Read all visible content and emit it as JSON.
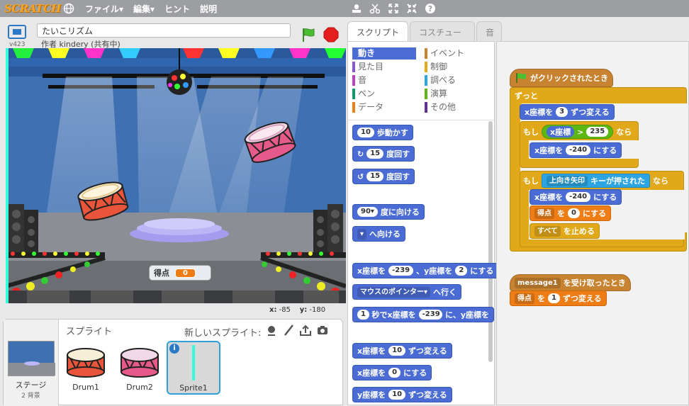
{
  "topbar": {
    "logo": "SCRATCH",
    "menus": [
      "ファイル▾",
      "編集▾",
      "ヒント",
      "説明"
    ]
  },
  "project": {
    "version": "v423",
    "title": "たいこリズム",
    "author": "作者 kindery (共有中)"
  },
  "stage": {
    "score_label": "得点",
    "score_value": "0",
    "x_label": "x:",
    "x_value": "-85",
    "y_label": "y:",
    "y_value": "-180"
  },
  "sprites": {
    "header": "スプライト",
    "new_sprite": "新しいスプライト:",
    "stage_label": "ステージ",
    "stage_sub": "2 背景",
    "items": [
      "Drum1",
      "Drum2",
      "Sprite1"
    ]
  },
  "tabs": [
    "スクリプト",
    "コスチューム",
    "音"
  ],
  "categories": {
    "left": [
      "動き",
      "見た目",
      "音",
      "ペン",
      "データ"
    ],
    "right": [
      "イベント",
      "制御",
      "調べる",
      "演算",
      "その他"
    ]
  },
  "palette": {
    "move": {
      "v": "10",
      "t": "歩動かす"
    },
    "turn_r": {
      "v": "15",
      "t": "度回す"
    },
    "turn_l": {
      "v": "15",
      "t": "度回す"
    },
    "point_dir": {
      "v": "90▾",
      "t": "度に向ける"
    },
    "point_to": {
      "v": "▾",
      "t": "へ向ける"
    },
    "goto_xy": {
      "a": "x座標を",
      "x": "-239",
      "b": "、y座標を",
      "y": "2",
      "c": "にする"
    },
    "goto_mouse": {
      "v": "マウスのポインター▾",
      "t": "へ行く"
    },
    "glide": {
      "s": "1",
      "a": "秒でx座標を",
      "x": "-239",
      "b": "に、y座標を"
    },
    "change_x": {
      "a": "x座標を",
      "v": "10",
      "t": "ずつ変える"
    },
    "set_x": {
      "a": "x座標を",
      "v": "0",
      "t": "にする"
    },
    "change_y": {
      "a": "y座標を",
      "v": "10",
      "t": "ずつ変える"
    }
  },
  "script": {
    "hat1": "がクリックされたとき",
    "forever": "ずっと",
    "cx": {
      "a": "x座標を",
      "v": "3",
      "t": "ずつ変える"
    },
    "if1": {
      "a": "もし",
      "prop": "x座標",
      "op": ">",
      "v": "235",
      "b": "なら"
    },
    "setx1": {
      "a": "x座標を",
      "v": "-240",
      "t": "にする"
    },
    "if2": {
      "a": "もし",
      "key": "上向き矢印",
      "t": "キーが押された",
      "b": "なら"
    },
    "setx2": {
      "a": "x座標を",
      "v": "-240",
      "t": "にする"
    },
    "setscore": {
      "var": "得点",
      "a": "を",
      "v": "0",
      "t": "にする"
    },
    "stop": {
      "v": "すべて",
      "t": "を止める"
    },
    "hat2": {
      "msg": "message1",
      "t": "を受け取ったとき"
    },
    "change_score": {
      "var": "得点",
      "a": "を",
      "v": "1",
      "t": "ずつ変える"
    }
  }
}
